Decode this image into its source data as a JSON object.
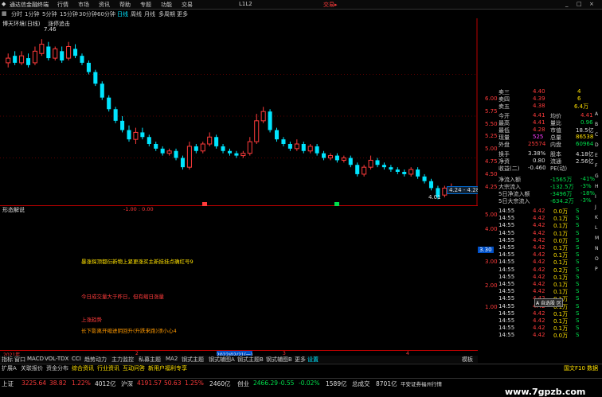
{
  "window": {
    "title": "通达信金融终端",
    "menu": [
      "行情",
      "市场",
      "资讯",
      "帮助",
      "专题",
      "功能",
      "交易",
      "L1L2"
    ],
    "trade_label": "交易▸",
    "system_buttons": [
      "_",
      "□",
      "×"
    ]
  },
  "periods": [
    "分时",
    "1分钟",
    "5分钟",
    "15分钟",
    "30分钟",
    "60分钟",
    "日线",
    "周线",
    "月线",
    "多周期",
    "更多"
  ],
  "active_period": "日线",
  "chart": {
    "label": "博天环境(日线)",
    "label2": "涨停追击",
    "price_high_label": "7.46",
    "price_low_label": "4.01",
    "range_label": "4.24 - 4.28",
    "mid_marker": "-1.00 : 0.00",
    "yaxis": [
      "6.00",
      "5.75",
      "5.50",
      "5.25",
      "5.00",
      "4.75",
      "4.50",
      "4.25"
    ],
    "lower_label": "形态解说",
    "lower_scale": [
      "5.00",
      "4.00",
      "3.00",
      "2.00",
      "1.00"
    ],
    "lower_current": "3.30",
    "annotations": [
      {
        "text": "暴涨探顶都衍新物上紧更涨买主新挂挂点确红号9",
        "color": "#ffe100"
      },
      {
        "text": "今日成交量大于昨日，但有缩日涨量",
        "color": "#ff3b3b"
      },
      {
        "text": "上涨趋势",
        "color": "#ff3b3b"
      },
      {
        "text": "长下影离开缩进阴回升(升跌来跑)须小心4",
        "color": "#ff9900"
      }
    ]
  },
  "chart_data": {
    "type": "candlestick",
    "ylim": [
      4.0,
      7.6
    ],
    "candles": [
      {
        "o": 6.95,
        "c": 7.05,
        "h": 7.15,
        "l": 6.85
      },
      {
        "o": 7.1,
        "c": 6.95,
        "h": 7.2,
        "l": 6.9
      },
      {
        "o": 6.95,
        "c": 7.1,
        "h": 7.2,
        "l": 6.9
      },
      {
        "o": 7.05,
        "c": 6.9,
        "h": 7.15,
        "l": 6.85
      },
      {
        "o": 6.95,
        "c": 7.2,
        "h": 7.3,
        "l": 6.9
      },
      {
        "o": 7.15,
        "c": 7.35,
        "h": 7.46,
        "l": 7.1
      },
      {
        "o": 7.3,
        "c": 7.05,
        "h": 7.4,
        "l": 7.0
      },
      {
        "o": 7.05,
        "c": 7.25,
        "h": 7.3,
        "l": 7.0
      },
      {
        "o": 7.2,
        "c": 7.0,
        "h": 7.3,
        "l": 6.95
      },
      {
        "o": 7.05,
        "c": 7.3,
        "h": 7.4,
        "l": 7.0
      },
      {
        "o": 7.25,
        "c": 7.1,
        "h": 7.35,
        "l": 7.05
      },
      {
        "o": 7.1,
        "c": 6.95,
        "h": 7.15,
        "l": 6.9
      },
      {
        "o": 6.95,
        "c": 6.75,
        "h": 7.0,
        "l": 6.7
      },
      {
        "o": 6.75,
        "c": 6.5,
        "h": 6.8,
        "l": 6.45
      },
      {
        "o": 6.5,
        "c": 6.2,
        "h": 6.55,
        "l": 6.15
      },
      {
        "o": 6.2,
        "c": 5.95,
        "h": 6.25,
        "l": 5.9
      },
      {
        "o": 5.95,
        "c": 5.7,
        "h": 6.0,
        "l": 5.65
      },
      {
        "o": 5.7,
        "c": 5.5,
        "h": 5.8,
        "l": 5.45
      },
      {
        "o": 5.5,
        "c": 5.3,
        "h": 5.6,
        "l": 5.25
      },
      {
        "o": 5.3,
        "c": 5.45,
        "h": 5.55,
        "l": 5.2
      },
      {
        "o": 5.45,
        "c": 5.35,
        "h": 5.55,
        "l": 5.3
      },
      {
        "o": 5.35,
        "c": 5.2,
        "h": 5.4,
        "l": 5.15
      },
      {
        "o": 5.2,
        "c": 5.1,
        "h": 5.25,
        "l": 5.05
      },
      {
        "o": 5.1,
        "c": 5.0,
        "h": 5.15,
        "l": 4.95
      },
      {
        "o": 5.0,
        "c": 5.05,
        "h": 5.1,
        "l": 4.95
      },
      {
        "o": 5.05,
        "c": 4.9,
        "h": 5.1,
        "l": 4.85
      },
      {
        "o": 4.9,
        "c": 4.7,
        "h": 4.95,
        "l": 4.65
      },
      {
        "o": 4.7,
        "c": 5.15,
        "h": 5.25,
        "l": 4.65
      },
      {
        "o": 5.15,
        "c": 5.05,
        "h": 5.2,
        "l": 5.0
      },
      {
        "o": 5.05,
        "c": 5.2,
        "h": 5.25,
        "l": 5.0
      },
      {
        "o": 5.2,
        "c": 5.35,
        "h": 5.45,
        "l": 5.15
      },
      {
        "o": 5.35,
        "c": 5.15,
        "h": 5.4,
        "l": 5.1
      },
      {
        "o": 5.15,
        "c": 5.05,
        "h": 5.2,
        "l": 5.0
      },
      {
        "o": 5.05,
        "c": 5.0,
        "h": 5.1,
        "l": 4.95
      },
      {
        "o": 5.0,
        "c": 4.95,
        "h": 5.05,
        "l": 4.9
      },
      {
        "o": 4.95,
        "c": 5.0,
        "h": 5.05,
        "l": 4.9
      },
      {
        "o": 5.0,
        "c": 5.25,
        "h": 5.35,
        "l": 4.95
      },
      {
        "o": 5.25,
        "c": 5.7,
        "h": 5.85,
        "l": 5.2
      },
      {
        "o": 5.7,
        "c": 5.9,
        "h": 6.0,
        "l": 5.65
      },
      {
        "o": 5.9,
        "c": 5.5,
        "h": 5.95,
        "l": 5.45
      },
      {
        "o": 5.5,
        "c": 5.3,
        "h": 5.55,
        "l": 5.25
      },
      {
        "o": 5.3,
        "c": 5.2,
        "h": 5.35,
        "l": 5.15
      },
      {
        "o": 5.2,
        "c": 5.1,
        "h": 5.25,
        "l": 5.05
      },
      {
        "o": 5.1,
        "c": 5.2,
        "h": 5.3,
        "l": 5.05
      },
      {
        "o": 5.2,
        "c": 5.05,
        "h": 5.25,
        "l": 5.0
      },
      {
        "o": 5.05,
        "c": 5.15,
        "h": 5.2,
        "l": 5.0
      },
      {
        "o": 5.15,
        "c": 5.0,
        "h": 5.2,
        "l": 4.95
      },
      {
        "o": 5.0,
        "c": 4.9,
        "h": 5.05,
        "l": 4.85
      },
      {
        "o": 4.9,
        "c": 4.95,
        "h": 5.0,
        "l": 4.85
      },
      {
        "o": 4.95,
        "c": 4.85,
        "h": 5.0,
        "l": 4.8
      },
      {
        "o": 4.85,
        "c": 4.9,
        "h": 4.95,
        "l": 4.8
      },
      {
        "o": 4.9,
        "c": 4.75,
        "h": 4.95,
        "l": 4.7
      },
      {
        "o": 4.75,
        "c": 4.55,
        "h": 4.8,
        "l": 4.5
      },
      {
        "o": 4.55,
        "c": 4.7,
        "h": 4.75,
        "l": 4.5
      },
      {
        "o": 4.7,
        "c": 4.85,
        "h": 4.95,
        "l": 4.65
      },
      {
        "o": 4.85,
        "c": 4.75,
        "h": 4.9,
        "l": 4.7
      },
      {
        "o": 4.75,
        "c": 4.7,
        "h": 4.8,
        "l": 4.65
      },
      {
        "o": 4.7,
        "c": 4.65,
        "h": 4.75,
        "l": 4.6
      },
      {
        "o": 4.65,
        "c": 4.6,
        "h": 4.7,
        "l": 4.55
      },
      {
        "o": 4.6,
        "c": 4.55,
        "h": 4.65,
        "l": 4.5
      },
      {
        "o": 4.55,
        "c": 4.65,
        "h": 4.7,
        "l": 4.5
      },
      {
        "o": 4.65,
        "c": 4.5,
        "h": 4.7,
        "l": 4.45
      },
      {
        "o": 4.5,
        "c": 4.4,
        "h": 4.55,
        "l": 4.35
      },
      {
        "o": 4.4,
        "c": 4.25,
        "h": 4.45,
        "l": 4.2
      },
      {
        "o": 4.25,
        "c": 4.05,
        "h": 4.3,
        "l": 4.01
      },
      {
        "o": 4.1,
        "c": 4.25,
        "h": 4.3,
        "l": 4.05
      },
      {
        "o": 4.25,
        "c": 4.28,
        "h": 4.35,
        "l": 4.24
      }
    ]
  },
  "quote": {
    "asks": [
      [
        "卖三",
        "4.40",
        "4"
      ],
      [
        "卖四",
        "4.39",
        "6"
      ],
      [
        "卖五",
        "4.38",
        "6.4万"
      ]
    ],
    "stats": [
      [
        "今开",
        "4.41",
        "均价",
        "4.41"
      ],
      [
        "最高",
        "4.41",
        "量比",
        "0.96"
      ],
      [
        "最低",
        "4.28",
        "市值",
        "18.5亿"
      ],
      [
        "现量",
        "525",
        "总量",
        "86538"
      ],
      [
        "外盘",
        "25574",
        "内盘",
        "60964"
      ],
      [
        "换手",
        "3.38%",
        "股本",
        "4.18亿"
      ],
      [
        "净资",
        "0.80",
        "流通",
        "2.56亿"
      ],
      [
        "收益(二)",
        "-0.460",
        "PE(动)",
        ""
      ]
    ],
    "flows": [
      [
        "净流入额",
        "-1565万",
        "-41%"
      ],
      [
        "大宗流入",
        "-132.5万",
        "-3%"
      ],
      [
        "5日净流入额",
        "-3496万",
        "-18%"
      ],
      [
        "5日大宗流入",
        "-634.2万",
        "-3%"
      ]
    ],
    "ticks_time": "14:55",
    "ticks": [
      [
        "14:55",
        "4.42",
        "0.0万",
        "S"
      ],
      [
        "14:55",
        "4.42",
        "0.1万",
        "S"
      ],
      [
        "14:55",
        "4.42",
        "0.1万",
        "S"
      ],
      [
        "14:55",
        "4.42",
        "0.1万",
        "S"
      ],
      [
        "14:55",
        "4.42",
        "0.0万",
        "S"
      ],
      [
        "14:55",
        "4.42",
        "0.1万",
        "S"
      ],
      [
        "14:55",
        "4.42",
        "0.1万",
        "S"
      ],
      [
        "14:55",
        "4.42",
        "0.1万",
        "S"
      ],
      [
        "14:55",
        "4.42",
        "0.2万",
        "S"
      ],
      [
        "14:55",
        "4.42",
        "0.1万",
        "S"
      ],
      [
        "14:55",
        "4.42",
        "0.1万",
        "S"
      ],
      [
        "14:55",
        "4.42",
        "0.1万",
        "S"
      ],
      [
        "14:55",
        "4.42",
        "0.1万",
        "S"
      ],
      [
        "14:55",
        "4.42",
        "0.1万",
        "S"
      ],
      [
        "14:55",
        "4.42",
        "0.1万",
        "S"
      ],
      [
        "14:55",
        "4.42",
        "0.1万",
        "S"
      ],
      [
        "14:55",
        "4.42",
        "0.1万",
        "S"
      ],
      [
        "14:55",
        "4.42",
        "0.0万",
        "S"
      ]
    ],
    "side_marks": [
      "A",
      "B",
      "C",
      "D",
      "E",
      "F",
      "G",
      "H",
      "I",
      "J",
      "K",
      "L",
      "M",
      "N",
      "O",
      "P"
    ],
    "popup_label": "A 自选股 区"
  },
  "date_axis": {
    "left": "2021年",
    "mid": "2022/02/21(一)",
    "marks": [
      "2",
      "3",
      "4"
    ]
  },
  "tabsA": [
    "指标",
    "窗口",
    "MACD",
    "VOL-TDX",
    "CCI",
    "趋势动力",
    "主力监控",
    "私募主题",
    "MA2",
    "钢式主题",
    "钢式辅图A",
    "钢式主题B",
    "钢式辅图B",
    "更多",
    "设置"
  ],
  "tabsA_right": "模板",
  "tabsB": [
    "扩展A",
    "关联报价",
    "资金分布",
    "综合资讯",
    "行业资讯",
    "互动问答",
    "新用户福利专享"
  ],
  "tabsB_right": "国文F10 数据",
  "status": [
    {
      "k": "上证",
      "v": "3225.64",
      "c": "38.82",
      "p": "1.22%",
      "a": "4012亿"
    },
    {
      "k": "沪深",
      "v": "4191.57",
      "c": "50.63",
      "p": "1.25%",
      "a": "2460亿"
    },
    {
      "k": "创业",
      "v": "2466.29",
      "c": "-0.55",
      "p": "-0.02%",
      "a": "1589亿"
    },
    {
      "k": "总成交",
      "v": "",
      "c": "",
      "p": "",
      "a": "8701亿"
    }
  ],
  "status_right": "平安证券福州行情",
  "watermark": "www.7gpzb.com",
  "colors": {
    "up": "#ff3b3b",
    "down": "#00e5ff",
    "grid": "#8b0000",
    "bg": "#000000"
  }
}
